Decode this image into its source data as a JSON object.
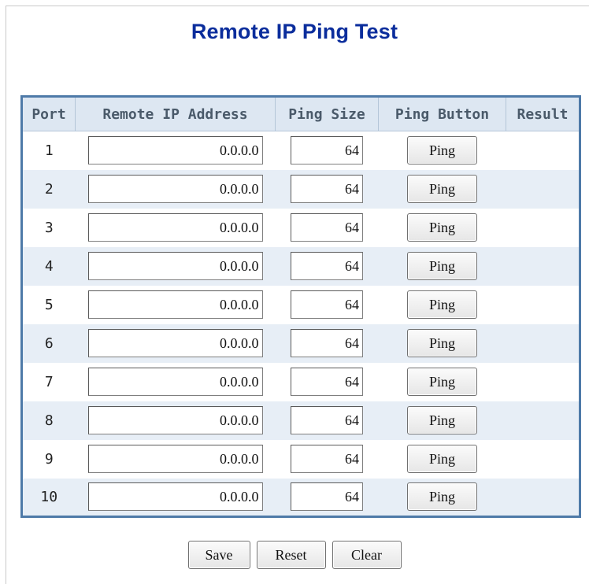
{
  "page": {
    "title": "Remote IP Ping Test"
  },
  "table": {
    "headers": {
      "port": "Port",
      "remote_ip": "Remote IP Address",
      "ping_size": "Ping Size",
      "ping_button": "Ping Button",
      "result": "Result"
    },
    "rows": [
      {
        "port": "1",
        "ip": "0.0.0.0",
        "size": "64",
        "button": "Ping",
        "result": ""
      },
      {
        "port": "2",
        "ip": "0.0.0.0",
        "size": "64",
        "button": "Ping",
        "result": ""
      },
      {
        "port": "3",
        "ip": "0.0.0.0",
        "size": "64",
        "button": "Ping",
        "result": ""
      },
      {
        "port": "4",
        "ip": "0.0.0.0",
        "size": "64",
        "button": "Ping",
        "result": ""
      },
      {
        "port": "5",
        "ip": "0.0.0.0",
        "size": "64",
        "button": "Ping",
        "result": ""
      },
      {
        "port": "6",
        "ip": "0.0.0.0",
        "size": "64",
        "button": "Ping",
        "result": ""
      },
      {
        "port": "7",
        "ip": "0.0.0.0",
        "size": "64",
        "button": "Ping",
        "result": ""
      },
      {
        "port": "8",
        "ip": "0.0.0.0",
        "size": "64",
        "button": "Ping",
        "result": ""
      },
      {
        "port": "9",
        "ip": "0.0.0.0",
        "size": "64",
        "button": "Ping",
        "result": ""
      },
      {
        "port": "10",
        "ip": "0.0.0.0",
        "size": "64",
        "button": "Ping",
        "result": ""
      }
    ]
  },
  "actions": {
    "save": "Save",
    "reset": "Reset",
    "clear": "Clear"
  },
  "colors": {
    "title": "#0b2d9c",
    "table_border": "#4e7aa8",
    "header_background": "#dde7f2",
    "alternate_row_background": "#e7eef6"
  }
}
